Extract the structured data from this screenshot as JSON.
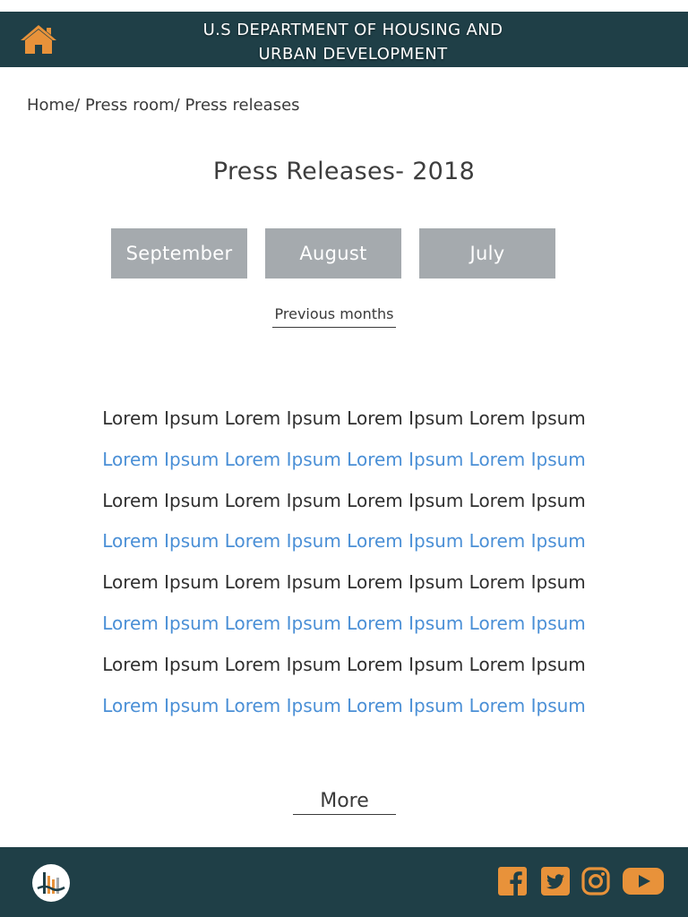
{
  "header": {
    "title_line1": "U.S DEPARTMENT OF HOUSING AND",
    "title_line2": "URBAN DEVELOPMENT",
    "home_icon": "home-icon"
  },
  "breadcrumb": {
    "items": [
      "Home/",
      "Press room/",
      "Press releases"
    ]
  },
  "page": {
    "title": "Press Releases- 2018"
  },
  "months": [
    "September",
    "August",
    "July"
  ],
  "previous_months_label": "Previous months",
  "releases": [
    "Lorem Ipsum Lorem Ipsum Lorem Ipsum Lorem Ipsum",
    "Lorem Ipsum Lorem Ipsum Lorem Ipsum Lorem Ipsum",
    "Lorem Ipsum Lorem Ipsum Lorem Ipsum Lorem Ipsum",
    "Lorem Ipsum Lorem Ipsum Lorem Ipsum Lorem Ipsum",
    "Lorem Ipsum Lorem Ipsum Lorem Ipsum Lorem Ipsum",
    "Lorem Ipsum Lorem Ipsum Lorem Ipsum Lorem Ipsum",
    "Lorem Ipsum Lorem Ipsum Lorem Ipsum Lorem Ipsum",
    "Lorem Ipsum Lorem Ipsum Lorem Ipsum Lorem Ipsum"
  ],
  "more_label": "More",
  "footer": {
    "logo_icon": "hud-logo-icon",
    "social_icons": [
      "facebook-icon",
      "twitter-icon",
      "instagram-icon",
      "youtube-icon"
    ]
  },
  "colors": {
    "header_bg": "#1f3f47",
    "accent_orange": "#e8923a",
    "month_button_bg": "#a5aaae",
    "link_blue": "#4a8fd6",
    "text_dark": "#3d3d3d"
  }
}
